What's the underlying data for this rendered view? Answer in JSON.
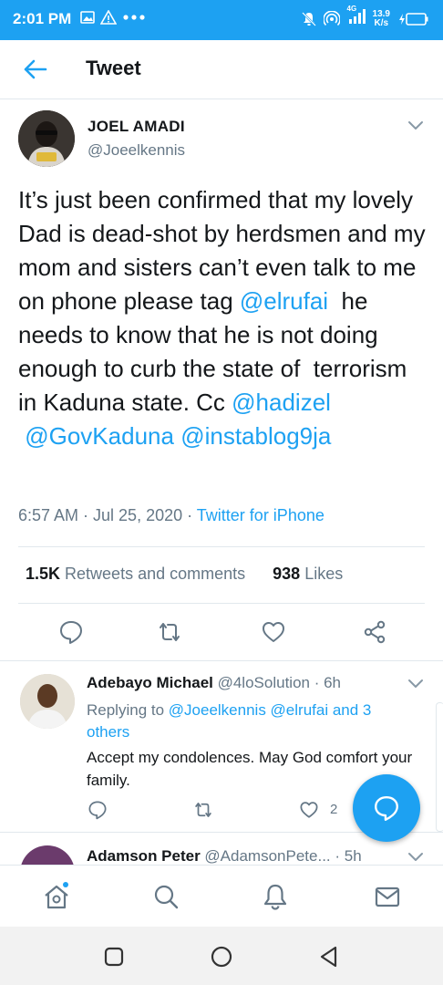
{
  "status_bar": {
    "time": "2:01 PM",
    "network_speed_value": "13.9",
    "network_speed_unit": "K/s",
    "network_type": "4G",
    "icons": [
      "gallery-icon",
      "warning-icon",
      "more-dots-icon",
      "mute-icon",
      "hotspot-icon",
      "signal-icon",
      "battery-icon"
    ]
  },
  "app_bar": {
    "title": "Tweet"
  },
  "tweet": {
    "author_name": "JOEL AMADI",
    "author_handle": "@Joeelkennis",
    "text_parts": [
      "It’s just been confirmed that my lovely Dad is dead-shot by herdsmen and my mom and sisters can’t even talk to me on phone please tag ",
      "@elrufai",
      "  he needs to know that he is not doing enough to curb the state of  terrorism in Kaduna state. Cc ",
      "@hadizel",
      "\n ",
      "@GovKaduna",
      " ",
      "@instablog9ja"
    ],
    "timestamp": "6:57 AM · Jul 25, 2020 · ",
    "source": "Twitter for iPhone",
    "retweets_count": "1.5K",
    "retweets_label": " Retweets and comments",
    "likes_count": "938",
    "likes_label": " Likes"
  },
  "reply": {
    "name": "Adebayo Michael",
    "handle_time": " @4loSolution · 6h",
    "replying_prefix": "Replying to ",
    "replying_to": "@Joeelkennis @elrufai and 3 others",
    "text": "Accept my condolences. May God comfort your family.",
    "like_count": "2"
  },
  "reply2": {
    "name": "Adamson Peter",
    "handle_time": " @AdamsonPete... · 5h"
  },
  "colors": {
    "brand": "#1da1f2",
    "text": "#14171a",
    "muted": "#657786",
    "divider": "#e1e8ed"
  }
}
